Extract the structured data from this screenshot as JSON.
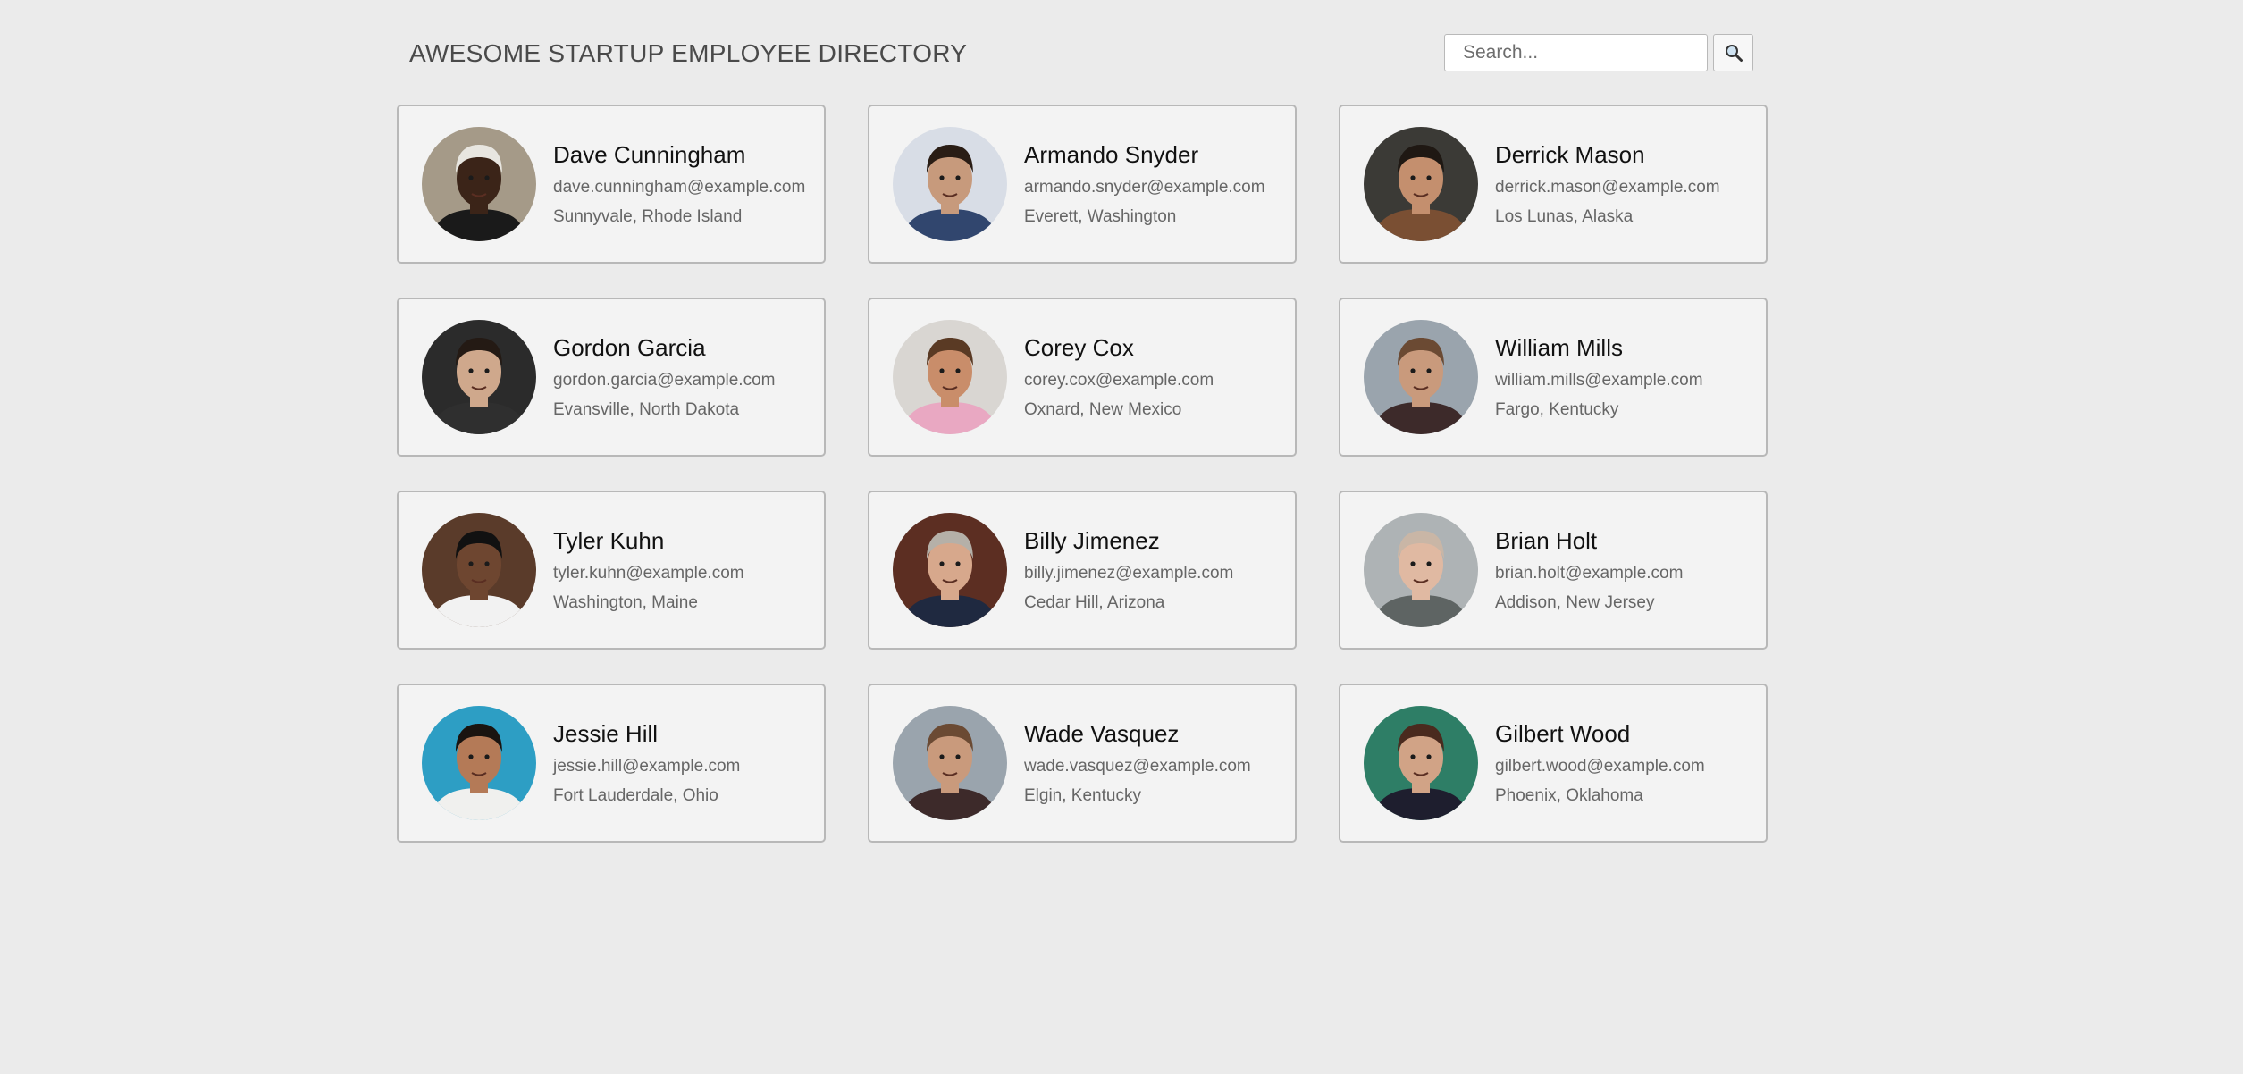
{
  "header": {
    "title": "AWESOME STARTUP EMPLOYEE DIRECTORY",
    "search_placeholder": "Search...",
    "search_icon": "magnifier-icon"
  },
  "employees": [
    {
      "name": "Dave Cunningham",
      "email": "dave.cunningham@example.com",
      "location": "Sunnyvale, Rhode Island",
      "avatar": {
        "bg": "#a59a88",
        "skin": "#3b2418",
        "hair": "#e8e6e0",
        "shirt": "#1a1a1a"
      }
    },
    {
      "name": "Armando Snyder",
      "email": "armando.snyder@example.com",
      "location": "Everett, Washington",
      "avatar": {
        "bg": "#d8dde6",
        "skin": "#c79a7c",
        "hair": "#2a1d15",
        "shirt": "#31466e"
      }
    },
    {
      "name": "Derrick Mason",
      "email": "derrick.mason@example.com",
      "location": "Los Lunas, Alaska",
      "avatar": {
        "bg": "#3b3a36",
        "skin": "#c48f6e",
        "hair": "#1f1813",
        "shirt": "#7a4f33"
      }
    },
    {
      "name": "Gordon Garcia",
      "email": "gordon.garcia@example.com",
      "location": "Evansville, North Dakota",
      "avatar": {
        "bg": "#2b2b2b",
        "skin": "#cfa88c",
        "hair": "#241a14",
        "shirt": "#2f2f2f"
      }
    },
    {
      "name": "Corey Cox",
      "email": "corey.cox@example.com",
      "location": "Oxnard, New Mexico",
      "avatar": {
        "bg": "#d9d6d2",
        "skin": "#c98d6a",
        "hair": "#5a3a24",
        "shirt": "#e9a8c2"
      }
    },
    {
      "name": "William Mills",
      "email": "william.mills@example.com",
      "location": "Fargo, Kentucky",
      "avatar": {
        "bg": "#9aa4ad",
        "skin": "#c99a7c",
        "hair": "#6b4a33",
        "shirt": "#3d2a2a"
      }
    },
    {
      "name": "Tyler Kuhn",
      "email": "tyler.kuhn@example.com",
      "location": "Washington, Maine",
      "avatar": {
        "bg": "#5a3b2a",
        "skin": "#6e4630",
        "hair": "#111111",
        "shirt": "#f2f2f2"
      }
    },
    {
      "name": "Billy Jimenez",
      "email": "billy.jimenez@example.com",
      "location": "Cedar Hill, Arizona",
      "avatar": {
        "bg": "#5c2e22",
        "skin": "#d7a88c",
        "hair": "#b5b0a8",
        "shirt": "#1f2940"
      }
    },
    {
      "name": "Brian Holt",
      "email": "brian.holt@example.com",
      "location": "Addison, New Jersey",
      "avatar": {
        "bg": "#aeb3b5",
        "skin": "#e0b9a2",
        "hair": "#c9b6a6",
        "shirt": "#5e6463"
      }
    },
    {
      "name": "Jessie Hill",
      "email": "jessie.hill@example.com",
      "location": "Fort Lauderdale, Ohio",
      "avatar": {
        "bg": "#2d9ec4",
        "skin": "#b47a57",
        "hair": "#1a1410",
        "shirt": "#f0f0ee"
      }
    },
    {
      "name": "Wade Vasquez",
      "email": "wade.vasquez@example.com",
      "location": "Elgin, Kentucky",
      "avatar": {
        "bg": "#9aa4ad",
        "skin": "#c99a7c",
        "hair": "#6b4a33",
        "shirt": "#3d2a2a"
      }
    },
    {
      "name": "Gilbert Wood",
      "email": "gilbert.wood@example.com",
      "location": "Phoenix, Oklahoma",
      "avatar": {
        "bg": "#2e7e66",
        "skin": "#d1a386",
        "hair": "#4a2a1e",
        "shirt": "#1e1e2e"
      }
    }
  ]
}
